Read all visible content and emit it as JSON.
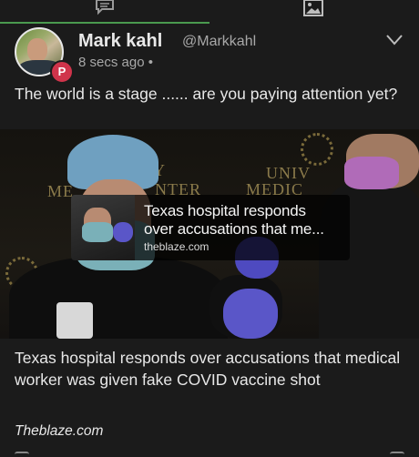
{
  "tabs": {
    "comment_icon": "comment-icon",
    "image_icon": "image-icon",
    "accent": "#4a9a4f"
  },
  "post": {
    "author": "Mark kahl",
    "handle": "@Markkahl",
    "time": "8 secs ago •",
    "badge": "P",
    "badge_color": "#d0344b",
    "text": "The world is a stage ...... are you paying attention yet?"
  },
  "link_preview": {
    "title_line1": "Texas hospital responds",
    "title_line2": "over accusations that me...",
    "domain": "theblaze.com"
  },
  "media_signs": {
    "left_sign": "ME",
    "left_sign2": "Y",
    "nter": "NTER",
    "univ": "UNIV",
    "medic": "MEDIC"
  },
  "article": {
    "headline": "Texas hospital responds over accusations that medical worker was given fake COVID vaccine shot",
    "source": "Theblaze.com"
  }
}
